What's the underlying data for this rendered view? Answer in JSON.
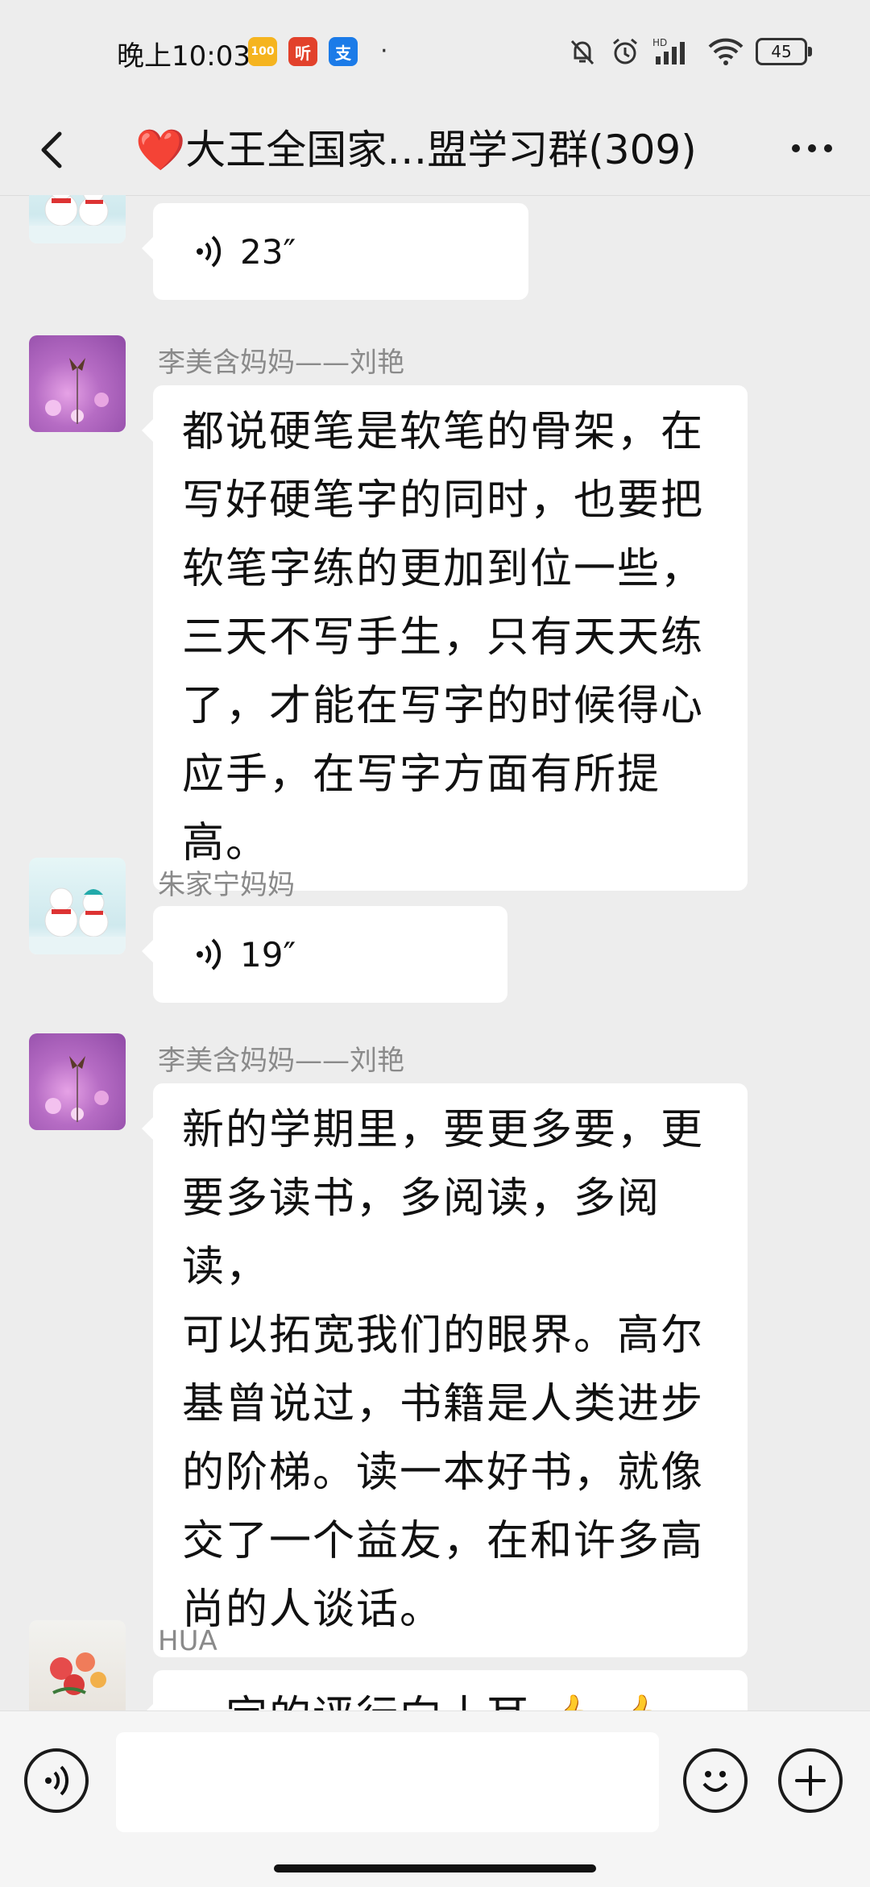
{
  "status_bar": {
    "time": "晚上10:03",
    "app_icons": [
      {
        "name": "100-app-icon",
        "label": "100",
        "color": "#f2b01e"
      },
      {
        "name": "ting-app-icon",
        "label": "听",
        "color": "#e2412b"
      },
      {
        "name": "alipay-app-icon",
        "label": "支",
        "color": "#1b7be8"
      }
    ],
    "network_label": "HD",
    "battery": "45"
  },
  "header": {
    "title": "❤️大王全国家…盟学习群(309)"
  },
  "messages": [
    {
      "sender": "",
      "type": "voice",
      "duration": "23″",
      "avatar": "snowman-avatar"
    },
    {
      "sender": "李美含妈妈——刘艳",
      "type": "text",
      "text_lines": [
        "都说硬笔是软笔的骨架，在",
        "写好硬笔字的同时，也要把",
        "软笔字练的更加到位一些，",
        "三天不写手生，只有天天练",
        "了，才能在写字的时候得心",
        "应手，在写字方面有所提高。"
      ],
      "avatar": "flower-avatar"
    },
    {
      "sender": "朱家宁妈妈",
      "type": "voice",
      "duration": "19″",
      "avatar": "snowman-avatar"
    },
    {
      "sender": "李美含妈妈——刘艳",
      "type": "text",
      "text_lines": [
        "新的学期里，要更多要，更",
        "要多读书，多阅读，多阅读，",
        "可以拓宽我们的眼界。高尔",
        "基曾说过，书籍是人类进步",
        "的阶梯。读一本好书，就像",
        "交了一个益友，在和许多高",
        "尚的人谈话。"
      ],
      "avatar": "flower-avatar"
    },
    {
      "sender": "HUA",
      "type": "text",
      "text_lines": [
        "一定的评行向十耳 👍 👍 👍"
      ],
      "avatar": "rose-avatar"
    }
  ],
  "input_bar": {
    "placeholder": ""
  }
}
